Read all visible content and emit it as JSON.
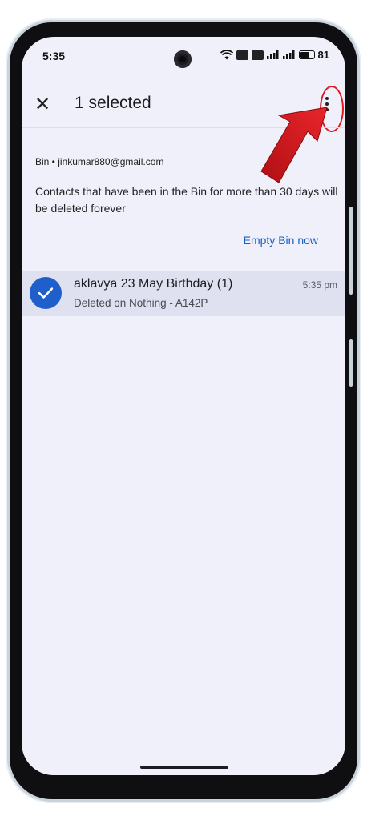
{
  "status_bar": {
    "time": "5:35",
    "battery": "81"
  },
  "header": {
    "selected_label": "1 selected"
  },
  "bin": {
    "account": "Bin • jinkumar880@gmail.com",
    "info": "Contacts that have been in the Bin for more than 30 days will be deleted forever",
    "empty_button": "Empty Bin now"
  },
  "contacts": [
    {
      "name": "aklavya 23 May Birthday (1)",
      "subtitle": "Deleted on Nothing - A142P",
      "time": "5:35 pm",
      "selected": true
    }
  ],
  "colors": {
    "screen_bg": "#eff0fa",
    "accent": "#1f5fcc",
    "link": "#1a5fc2",
    "annotation": "#e0191f"
  },
  "icons": {
    "close": "close-icon",
    "more": "more-vert-icon",
    "check": "check-icon",
    "arrow": "red-arrow-annotation"
  }
}
